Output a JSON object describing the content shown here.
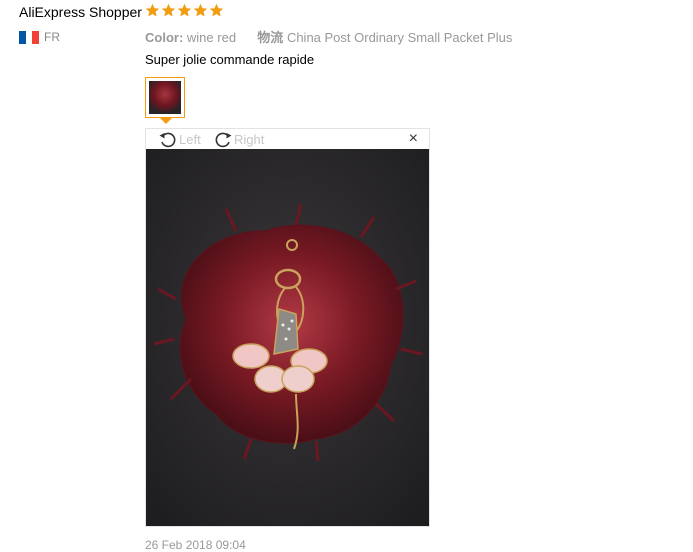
{
  "review": {
    "shopper_name": "AliExpress Shopper",
    "rating": 5,
    "country_code": "FR",
    "flag_colors": [
      "#0055a4",
      "#ffffff",
      "#ef4135"
    ],
    "color_label": "Color:",
    "color_value": "wine red",
    "logistics_label": "物流",
    "logistics_value": "China Post Ordinary Small Packet Plus",
    "text": "Super jolie commande rapide",
    "date": "26 Feb 2018 09:04"
  },
  "viewer": {
    "rotate_left_label": "Left",
    "rotate_right_label": "Right",
    "close_symbol": "×"
  },
  "colors": {
    "star": "#f39c12",
    "thumb_border": "#f39c12",
    "pompom": "#7a1a24"
  },
  "icons": [
    "star-icon",
    "rotate-left-icon",
    "rotate-right-icon",
    "close-icon"
  ]
}
